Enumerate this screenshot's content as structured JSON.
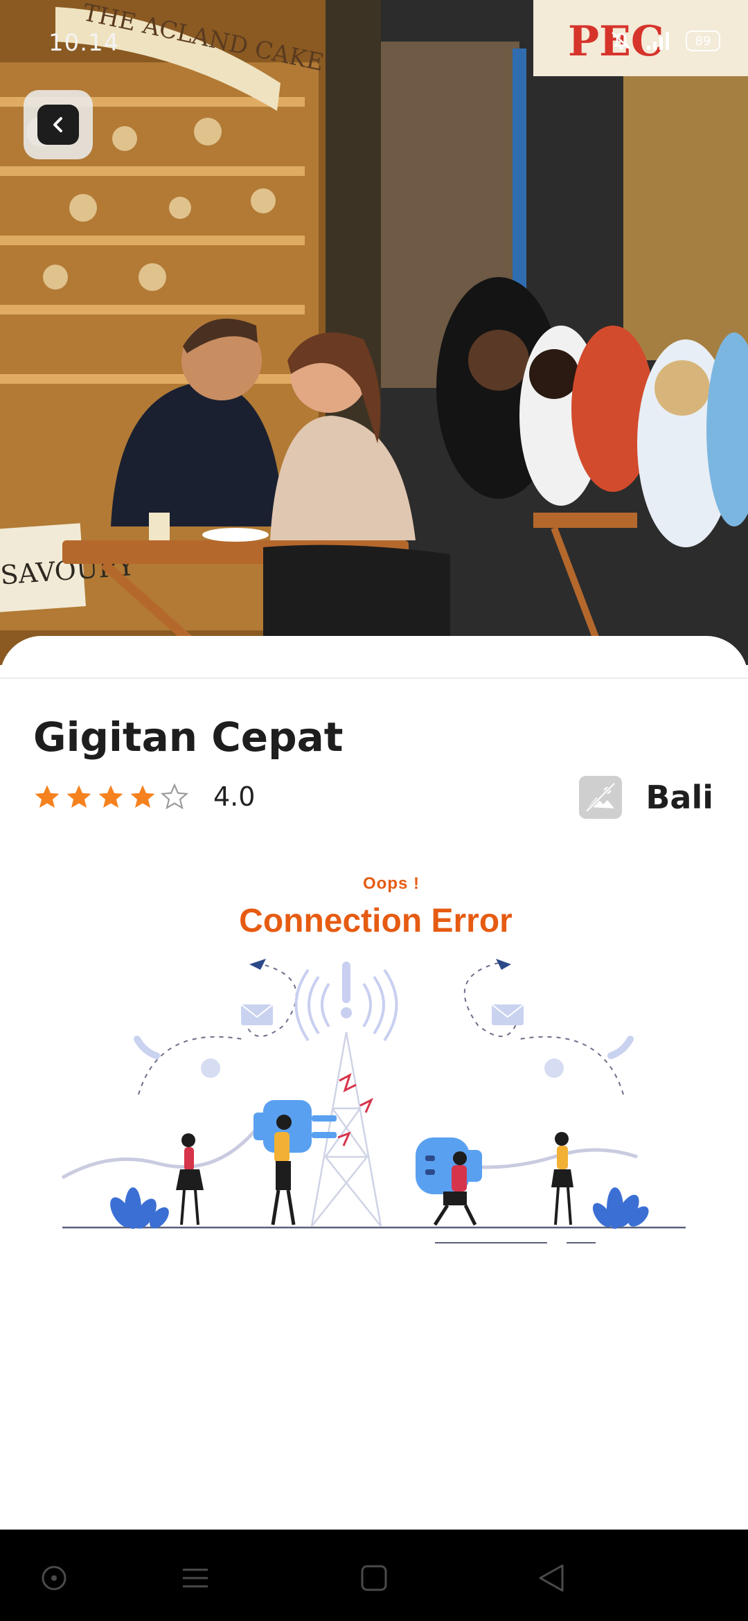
{
  "status_bar": {
    "time": "10.14",
    "battery": "89",
    "icons": [
      "bell-off-icon",
      "signal-icon",
      "battery-icon"
    ]
  },
  "hero": {
    "sign_left": "THE ACLAND CAKE SHOP",
    "sign_savoury": "SAVOURY",
    "sign_right": "PEC"
  },
  "header": {
    "back_icon": "chevron-left-icon"
  },
  "place": {
    "name": "Gigitan Cepat",
    "rating_value": "4.0",
    "rating_stars": 4,
    "rating_max": 5,
    "location": "Bali",
    "location_icon": "image-placeholder-icon"
  },
  "error": {
    "oops": "Oops !",
    "title": "Connection Error",
    "illustration": "connection-error-illustration"
  },
  "navbar": {
    "icons": [
      "circle-icon",
      "menu-icon",
      "square-icon",
      "triangle-back-icon"
    ]
  },
  "colors": {
    "accent": "#e65b12",
    "star": "#f5821f",
    "illustration_blue": "#5aa0f0"
  }
}
